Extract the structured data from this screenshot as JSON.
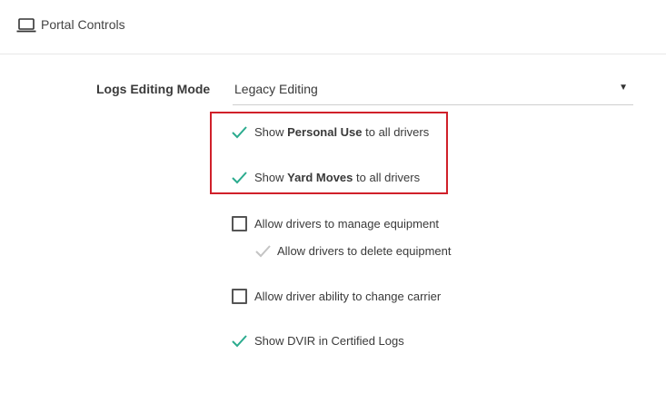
{
  "header": {
    "icon": "laptop-icon",
    "title": "Portal Controls"
  },
  "logs_editing": {
    "label": "Logs Editing Mode",
    "selected": "Legacy Editing",
    "arrow": "▼"
  },
  "options": {
    "personal_use": {
      "prefix": "Show ",
      "bold": "Personal Use",
      "suffix": " to all drivers",
      "checked": true
    },
    "yard_moves": {
      "prefix": "Show ",
      "bold": "Yard Moves",
      "suffix": " to all drivers",
      "checked": true
    },
    "manage_equipment": {
      "label": "Allow drivers to manage equipment",
      "checked": false
    },
    "delete_equipment": {
      "label": "Allow drivers to delete equipment",
      "checked": true,
      "disabled": true
    },
    "change_carrier": {
      "label": "Allow driver ability to change carrier",
      "checked": false
    },
    "dvir": {
      "label": "Show DVIR in Certified Logs",
      "checked": true
    }
  },
  "colors": {
    "check": "#2bab8e",
    "check_disabled": "#c4c4c4",
    "highlight": "#d0202a"
  }
}
